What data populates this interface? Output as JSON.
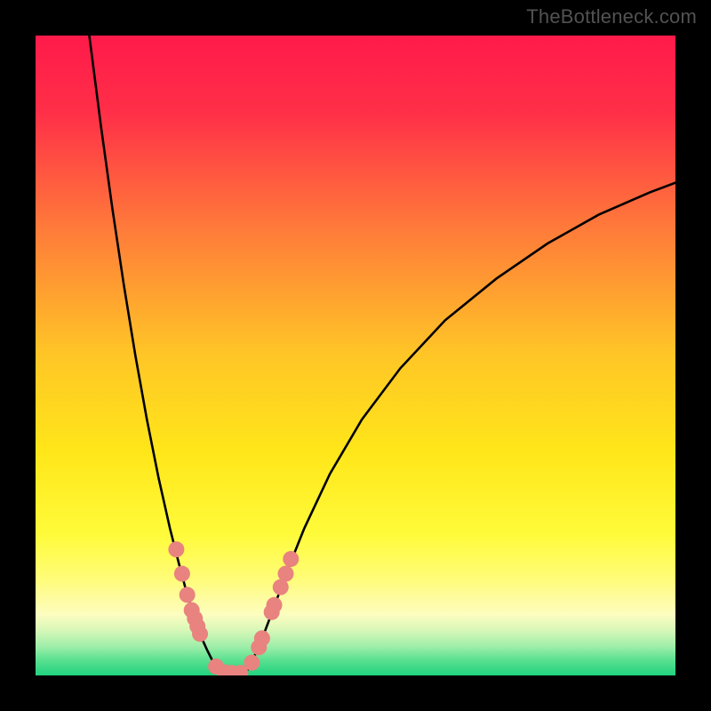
{
  "watermark": "TheBottleneck.com",
  "chart_data": {
    "type": "line",
    "title": "",
    "xlabel": "",
    "ylabel": "",
    "xlim": [
      0,
      100
    ],
    "ylim": [
      0,
      100
    ],
    "gradient_stops": [
      {
        "offset": 0.0,
        "color": "#ff1a4a"
      },
      {
        "offset": 0.12,
        "color": "#ff2f48"
      },
      {
        "offset": 0.3,
        "color": "#ff7a3a"
      },
      {
        "offset": 0.5,
        "color": "#ffc626"
      },
      {
        "offset": 0.65,
        "color": "#ffe619"
      },
      {
        "offset": 0.78,
        "color": "#fffb3a"
      },
      {
        "offset": 0.85,
        "color": "#fffc7a"
      },
      {
        "offset": 0.905,
        "color": "#fdfdc0"
      },
      {
        "offset": 0.93,
        "color": "#d6f7b8"
      },
      {
        "offset": 0.955,
        "color": "#9eeea9"
      },
      {
        "offset": 0.975,
        "color": "#5de191"
      },
      {
        "offset": 1.0,
        "color": "#1fd27e"
      }
    ],
    "series": [
      {
        "name": "left-curve",
        "x": [
          8.4,
          10.2,
          12.0,
          13.8,
          15.6,
          17.4,
          19.2,
          21.0,
          22.4,
          23.6,
          24.8,
          25.8,
          26.8,
          27.6,
          28.3,
          28.9,
          29.3
        ],
        "y": [
          100.0,
          86.0,
          73.0,
          61.0,
          50.0,
          40.0,
          31.0,
          23.0,
          17.5,
          13.0,
          9.2,
          6.2,
          4.0,
          2.4,
          1.3,
          0.5,
          0.0
        ]
      },
      {
        "name": "right-curve",
        "x": [
          32.5,
          33.2,
          34.2,
          35.5,
          37.2,
          39.2,
          42.0,
          46.0,
          51.0,
          57.0,
          64.0,
          72.0,
          80.0,
          88.0,
          96.0,
          100.0
        ],
        "y": [
          0.0,
          1.0,
          3.0,
          6.0,
          10.5,
          16.0,
          23.0,
          31.5,
          40.0,
          48.0,
          55.5,
          62.0,
          67.5,
          72.0,
          75.5,
          77.0
        ]
      }
    ],
    "markers_left": [
      {
        "x": 22.0,
        "y": 19.7
      },
      {
        "x": 22.9,
        "y": 15.9
      },
      {
        "x": 23.7,
        "y": 12.6
      },
      {
        "x": 24.4,
        "y": 10.2
      },
      {
        "x": 24.9,
        "y": 8.9
      },
      {
        "x": 25.3,
        "y": 7.7
      },
      {
        "x": 25.7,
        "y": 6.5
      },
      {
        "x": 28.2,
        "y": 1.4
      },
      {
        "x": 29.5,
        "y": 0.5
      },
      {
        "x": 30.6,
        "y": 0.4
      }
    ],
    "markers_right": [
      {
        "x": 32.0,
        "y": 0.4
      },
      {
        "x": 33.8,
        "y": 2.0
      },
      {
        "x": 34.9,
        "y": 4.4
      },
      {
        "x": 35.4,
        "y": 5.8
      },
      {
        "x": 36.9,
        "y": 9.9
      },
      {
        "x": 37.3,
        "y": 11.0
      },
      {
        "x": 38.3,
        "y": 13.8
      },
      {
        "x": 39.1,
        "y": 15.9
      },
      {
        "x": 39.9,
        "y": 18.2
      }
    ],
    "marker_style": {
      "fill": "#e8837f",
      "radius": 9
    }
  }
}
